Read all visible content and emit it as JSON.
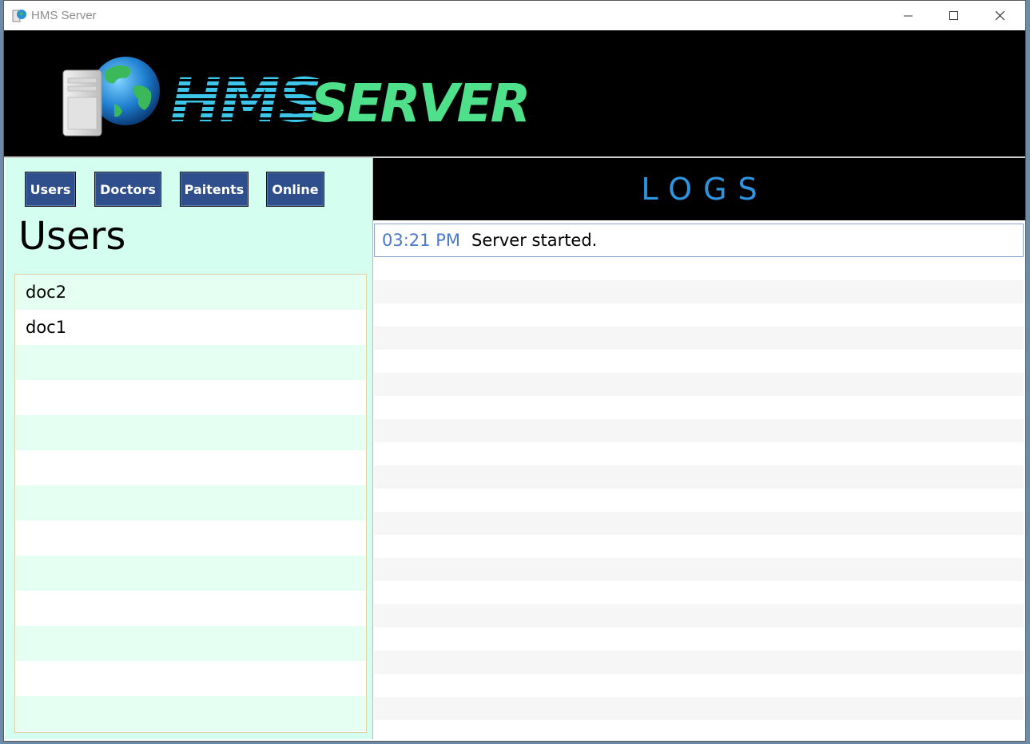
{
  "window": {
    "title": "HMS Server"
  },
  "banner": {
    "logo_part1": "HMS",
    "logo_part2": "SERVER"
  },
  "nav": {
    "users": "Users",
    "doctors": "Doctors",
    "paitents": "Paitents",
    "online": "Online"
  },
  "left_panel": {
    "heading": "Users",
    "items": [
      "doc2",
      "doc1",
      "",
      "",
      "",
      "",
      "",
      "",
      "",
      "",
      "",
      "",
      ""
    ]
  },
  "logs": {
    "title": "LOGS",
    "entries": [
      {
        "time": "03:21 PM",
        "message": "Server started."
      }
    ]
  },
  "colors": {
    "nav_button": "#2f4f8c",
    "left_panel_bg": "#d4fff0",
    "logs_title": "#2e96e0",
    "log_time": "#4a78cf",
    "logo_cyan": "#3ec6ea",
    "logo_green": "#4fe08c"
  }
}
